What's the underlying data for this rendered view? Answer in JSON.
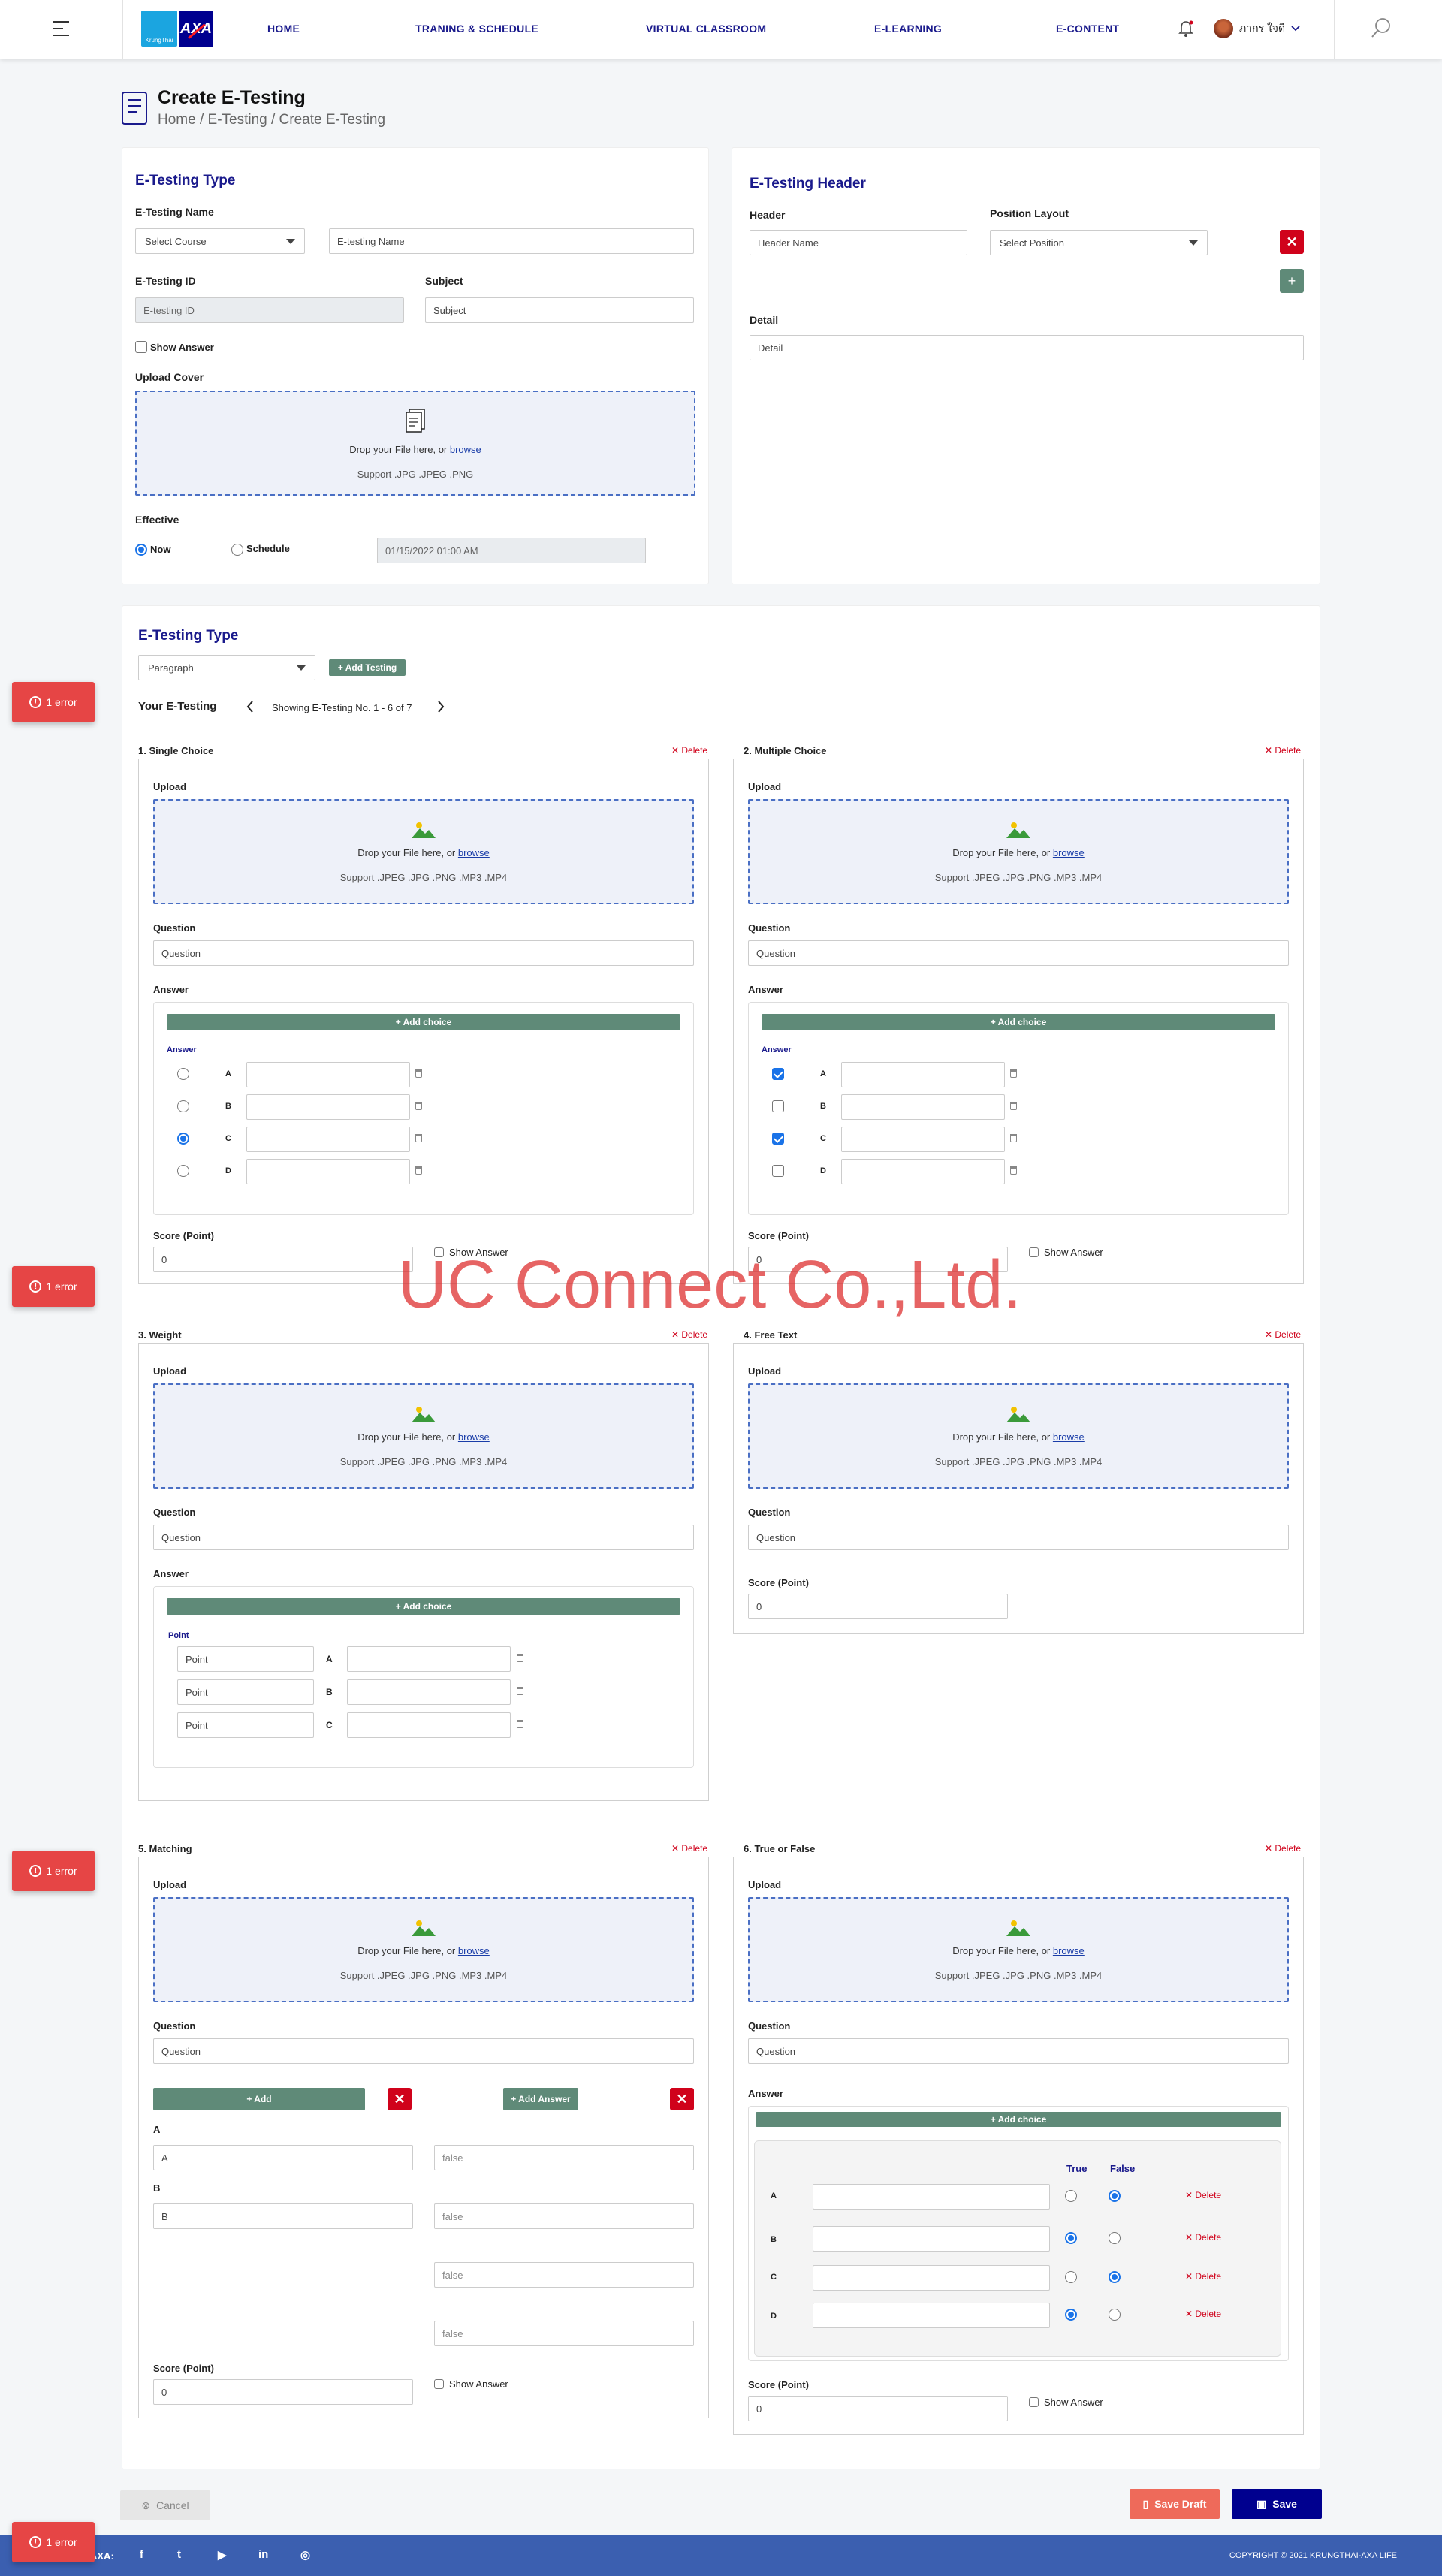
{
  "nav": {
    "home": "HOME",
    "training": "TRANING & SCHEDULE",
    "classroom": "VIRTUAL CLASSROOM",
    "elearning": "E-LEARNING",
    "econtent": "E-CONTENT",
    "user_name": "ภากร ใจดี",
    "logo_ktb": "KrungThai",
    "logo_axa": "AXA"
  },
  "page": {
    "title": "Create E-Testing",
    "breadcrumb": "Home / E-Testing / Create E-Testing"
  },
  "type_card": {
    "title": "E-Testing Type",
    "name_label": "E-Testing Name",
    "course_select": "Select Course",
    "name_placeholder": "E-testing Name",
    "id_label": "E-Testing ID",
    "id_placeholder": "E-testing ID",
    "subject_label": "Subject",
    "subject_placeholder": "Subject",
    "show_answer": "Show Answer",
    "upload_label": "Upload Cover",
    "drop_text": "Drop your File here, or ",
    "browse": "browse",
    "support": "Support .JPG .JPEG .PNG",
    "effective_label": "Effective",
    "now": "Now",
    "schedule": "Schedule",
    "datetime": "01/15/2022 01:00 AM"
  },
  "header_card": {
    "title": "E-Testing Header",
    "header_label": "Header",
    "header_placeholder": "Header Name",
    "position_label": "Position Layout",
    "position_select": "Select Position",
    "detail_label": "Detail",
    "detail_placeholder": "Detail"
  },
  "testing": {
    "title": "E-Testing Type",
    "type_select": "Paragraph",
    "add_testing": "+ Add Testing",
    "your_label": "Your E-Testing",
    "showing": "Showing E-Testing No. 1 - 6 of 7",
    "common": {
      "upload": "Upload",
      "drop": "Drop your File here, or ",
      "browse": "browse",
      "support": "Support .JPEG .JPG .PNG .MP3 .MP4",
      "question": "Question",
      "question_ph": "Question",
      "answer": "Answer",
      "add_choice": "+ Add choice",
      "answer_small": "Answer",
      "score": "Score (Point)",
      "score_val": "0",
      "show_answer": "Show Answer",
      "delete": "✕ Delete"
    },
    "q1": {
      "title": "1. Single Choice",
      "choices": [
        "A",
        "B",
        "C",
        "D"
      ]
    },
    "q2": {
      "title": "2. Multiple Choice",
      "choices": [
        "A",
        "B",
        "C",
        "D"
      ]
    },
    "q3": {
      "title": "3. Weight",
      "point_label": "Point",
      "point_ph": "Point",
      "choices": [
        "A",
        "B",
        "C"
      ]
    },
    "q4": {
      "title": "4. Free Text"
    },
    "q5": {
      "title": "5. Matching",
      "add": "+ Add",
      "add_answer": "+ Add Answer",
      "label_a": "A",
      "label_b": "B",
      "val_a": "A",
      "val_b": "B",
      "false_ph": "false"
    },
    "q6": {
      "title": "6. True or False",
      "true": "True",
      "false": "False",
      "rows": [
        "A",
        "B",
        "C",
        "D"
      ]
    }
  },
  "errors": {
    "label": "1 error"
  },
  "watermark": "UC Connect Co.,Ltd.",
  "actions": {
    "cancel": "Cancel",
    "draft": "Save Draft",
    "save": "Save"
  },
  "footer": {
    "label": "AXA:",
    "copyright": "COPYRIGHT © 2021 KRUNGTHAI-AXA LIFE",
    "fb": "f",
    "tw": "t",
    "yt": "▶",
    "li": "in",
    "ig": "◎"
  },
  "colors": {
    "navy": "#1a1a8c",
    "green": "#5f8a78",
    "red": "#d0021b",
    "footer": "#3b5fb0"
  }
}
